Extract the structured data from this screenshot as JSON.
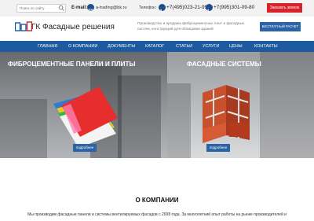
{
  "topbar": {
    "search_placeholder": "Поиск по сайту",
    "email_label": "E-mail:",
    "email": "a-trading@bk.ru",
    "phone_label": "Телефон:",
    "phone1": "+7(495)023-21-99",
    "phone2": "+7(995)301-09-80",
    "call_button": "Заказать звонок"
  },
  "header": {
    "brand": "ГК Фасадные решения",
    "tagline": "Производство и продажа фиброцементных плит и фасадных систем, конструкций для облицовки зданий",
    "calc_button": "БЕСПЛАТНЫЙ РАСЧЕТ"
  },
  "nav": {
    "items": [
      "ГЛАВНАЯ",
      "О КОМПАНИИ",
      "ДОКУМЕНТЫ",
      "КАТАЛОГ",
      "СТАТЬИ",
      "УСЛУГИ",
      "ЦЕНЫ",
      "КОНТАКТЫ"
    ]
  },
  "hero": {
    "left_title": "ФИБРОЦЕМЕНТНЫЕ ПАНЕЛИ И ПЛИТЫ",
    "right_title": "ФАСАДНЫЕ СИСТЕМЫ",
    "more_label": "подробнее"
  },
  "about": {
    "title": "О КОМПАНИИ",
    "text": "Мы производим фасадные панели и системы вентилируемых фасадов с 2008 года. За многолетний опыт работы на рынке производителей и"
  },
  "colors": {
    "nav": "#1e5aa0",
    "accent_red": "#d8232a",
    "button_blue": "#2a63a8",
    "topbar": "#f2f2f2"
  }
}
